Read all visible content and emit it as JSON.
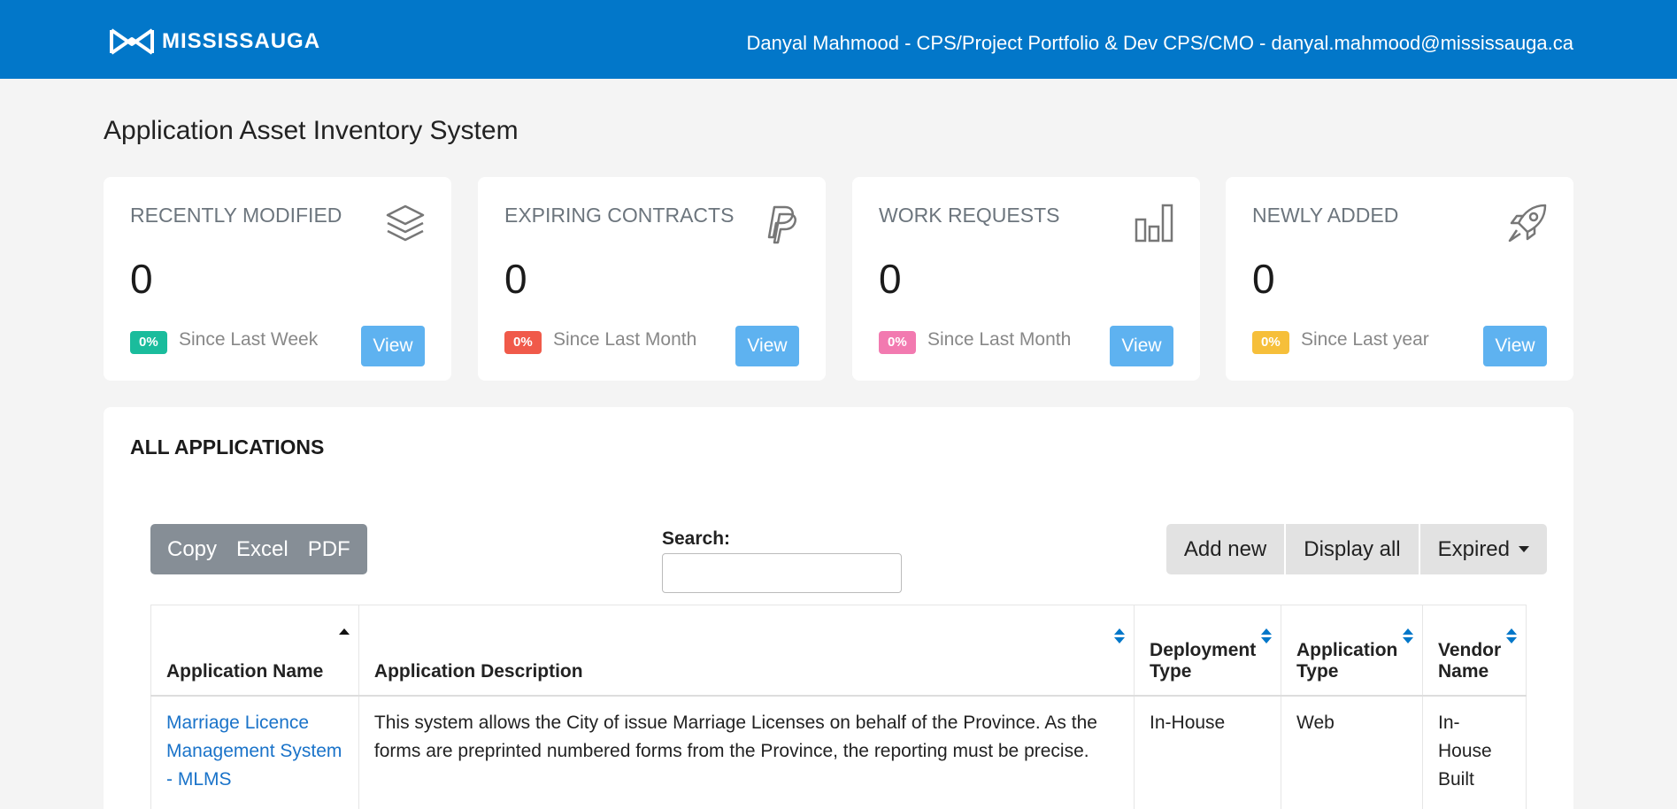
{
  "header": {
    "logo_text": "MISSISSAUGA",
    "user_info": "Danyal Mahmood - CPS/Project Portfolio & Dev CPS/CMO - danyal.mahmood@mississauga.ca",
    "bar_color": "#0277c9"
  },
  "page_title": "Application Asset Inventory System",
  "cards": [
    {
      "label": "RECENTLY MODIFIED",
      "value": "0",
      "badge": "0%",
      "badge_color": "#1abc9c",
      "since": "Since Last Week",
      "view": "View",
      "icon": "layers-icon"
    },
    {
      "label": "EXPIRING CONTRACTS",
      "value": "0",
      "badge": "0%",
      "badge_color": "#f05a4a",
      "since": "Since Last Month",
      "view": "View",
      "icon": "paypal-icon"
    },
    {
      "label": "WORK REQUESTS",
      "value": "0",
      "badge": "0%",
      "badge_color": "#f27ab0",
      "since": "Since Last Month",
      "view": "View",
      "icon": "bar-chart-icon"
    },
    {
      "label": "NEWLY ADDED",
      "value": "0",
      "badge": "0%",
      "badge_color": "#f6bf3a",
      "since": "Since Last year",
      "view": "View",
      "icon": "rocket-icon"
    }
  ],
  "panel": {
    "title": "ALL APPLICATIONS",
    "export_buttons": [
      "Copy",
      "Excel",
      "PDF"
    ],
    "search_label": "Search:",
    "search_value": "",
    "add_new": "Add new",
    "display_all": "Display all",
    "expired": "Expired"
  },
  "table": {
    "headers": [
      "Application Name",
      "Application Description",
      "Deployment Type",
      "Application Type",
      "Vendor Name"
    ],
    "rows": [
      {
        "name": "Marriage Licence Management System - MLMS",
        "description": "This system allows the City of issue Marriage Licenses on behalf of the Province. As the forms are preprinted numbered forms from the Province, the reporting must be precise.",
        "deployment": "In-House",
        "app_type": "Web",
        "vendor": "In-House Built"
      }
    ]
  }
}
